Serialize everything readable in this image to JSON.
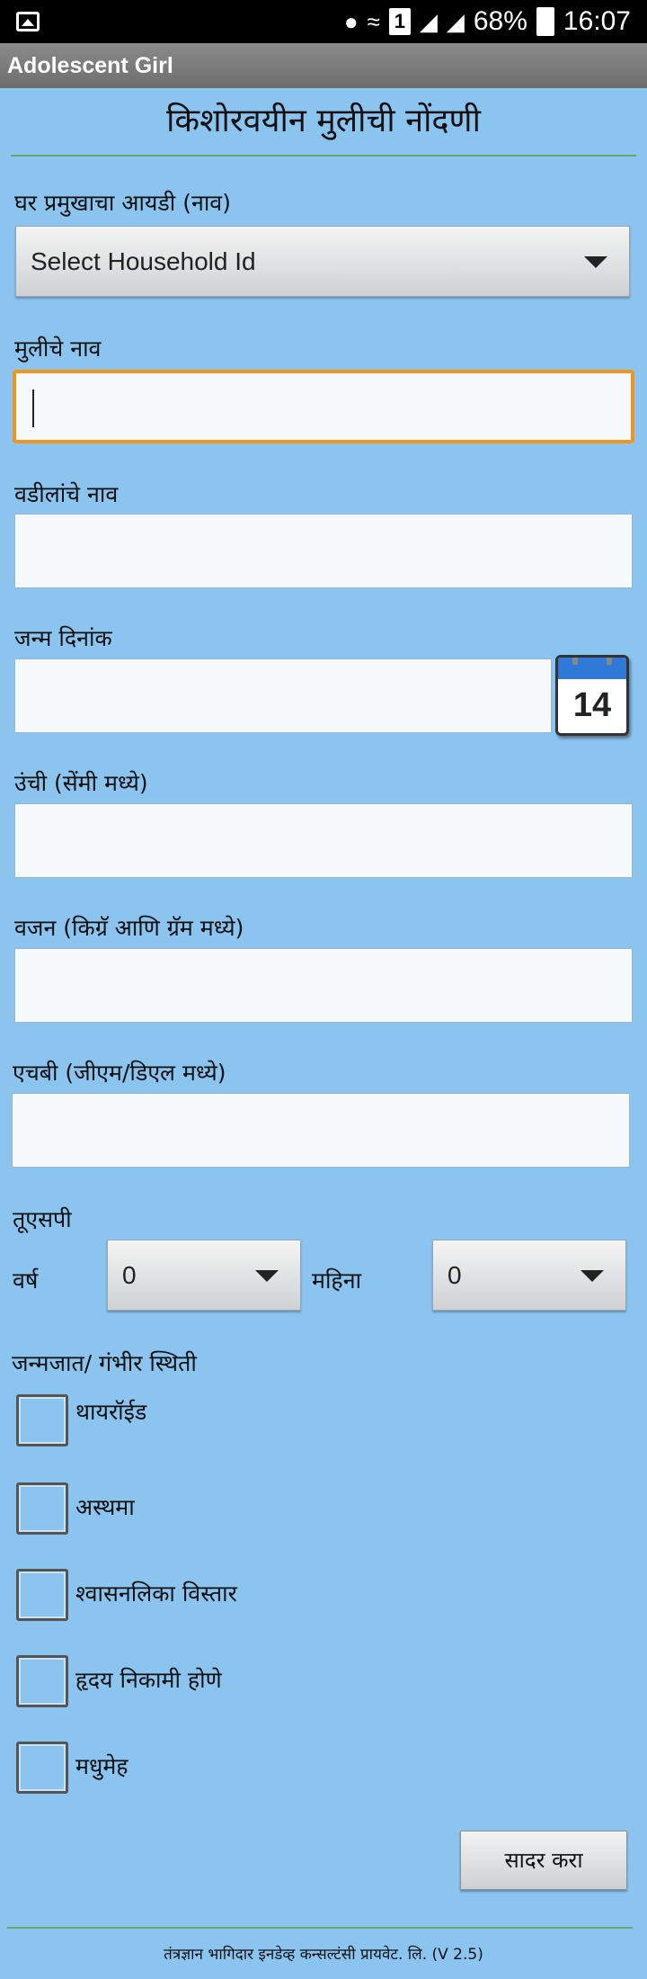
{
  "status_bar": {
    "icons": [
      "image-icon",
      "location-icon",
      "wifi-icon",
      "sim-1-icon",
      "signal-icon",
      "signal-r-icon",
      "battery-charging-icon"
    ],
    "sim_label": "1",
    "battery": "68%",
    "time": "16:07"
  },
  "app_bar": {
    "title": "Adolescent Girl"
  },
  "form": {
    "title": "किशोरवयीन मुलीची नोंदणी",
    "household": {
      "label": "घर प्रमुखाचा आयडी (नाव)",
      "selected": "Select Household Id"
    },
    "girl_name": {
      "label": "मुलीचे नाव",
      "value": ""
    },
    "father_name": {
      "label": "वडीलांचे नाव",
      "value": ""
    },
    "dob": {
      "label": "जन्म दिनांक",
      "value": "",
      "calendar_day": "14"
    },
    "height": {
      "label": "उंची (सेंमी मध्ये)",
      "value": ""
    },
    "weight": {
      "label": "वजन (किग्रॅ आणि ग्रॅम मध्ये)",
      "value": ""
    },
    "hb": {
      "label": "एचबी (जीएम/डिएल मध्ये)",
      "value": ""
    },
    "tusp": {
      "label": "तूएसपी",
      "year_label": "वर्ष",
      "year_value": "0",
      "month_label": "महिना",
      "month_value": "0"
    },
    "conditions": {
      "label": "जन्मजात/ गंभीर स्थिती",
      "items": [
        {
          "label": "थायरॉईड",
          "checked": false
        },
        {
          "label": "अस्थमा",
          "checked": false
        },
        {
          "label": "श्वासनलिका विस्तार",
          "checked": false
        },
        {
          "label": "हृदय निकामी होणे",
          "checked": false
        },
        {
          "label": "मधुमेह",
          "checked": false
        }
      ]
    },
    "submit_label": "सादर करा"
  },
  "footer": {
    "text": "तंत्रज्ञान भागिदार इनडेव्ह कन्सल्टंसी प्रायवेट. लि. (V 2.5)"
  }
}
